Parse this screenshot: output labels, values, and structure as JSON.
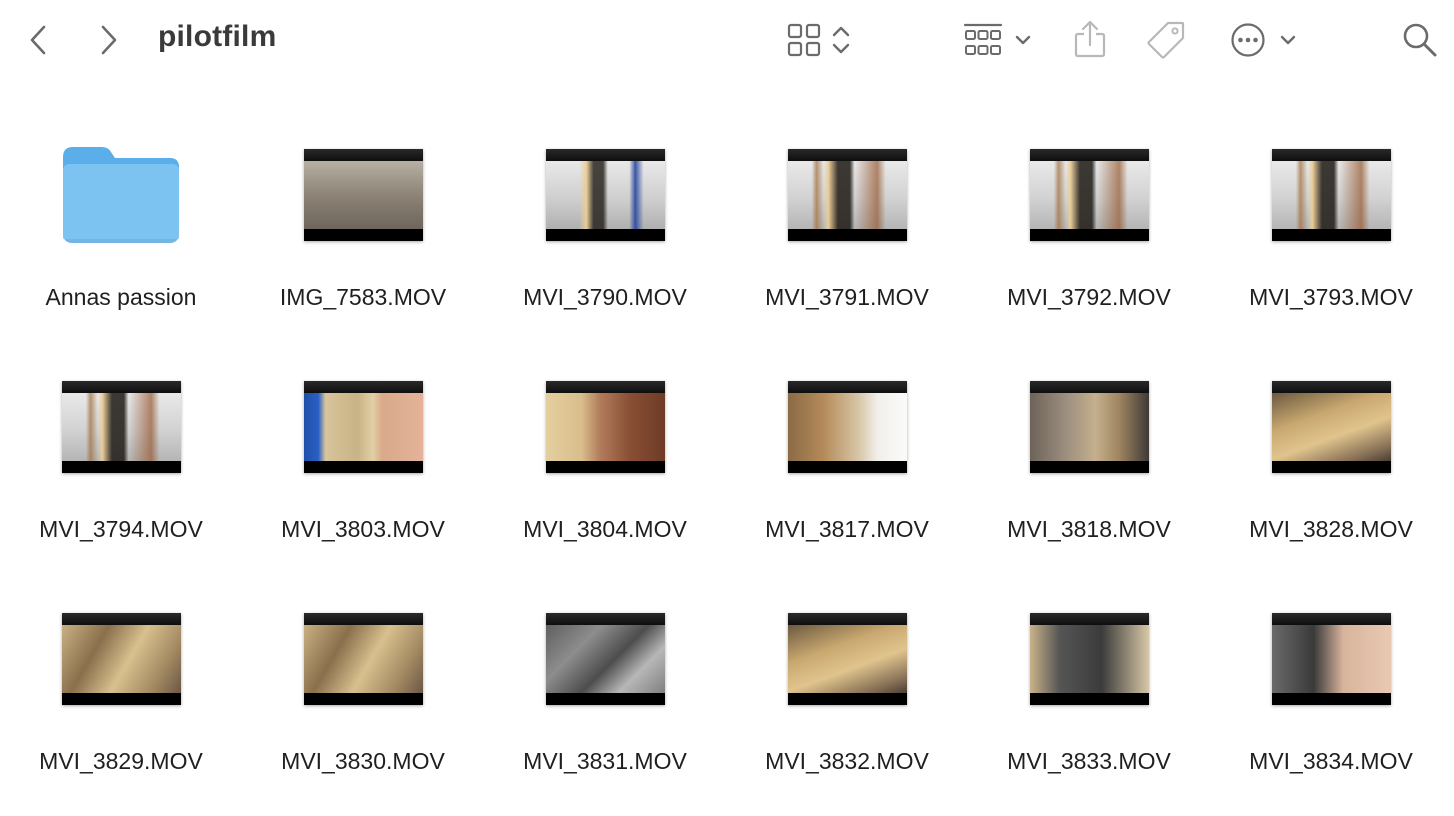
{
  "window": {
    "title": "pilotfilm"
  },
  "toolbar": {
    "back_icon": "chevron-left-icon",
    "forward_icon": "chevron-right-icon",
    "view_icon": "icon-grid-view-icon",
    "group_icon": "group-by-icon",
    "share_icon": "share-icon",
    "tag_icon": "tag-icon",
    "more_icon": "ellipsis-circle-icon",
    "search_icon": "search-icon"
  },
  "items": [
    {
      "name": "Annas passion",
      "kind": "folder"
    },
    {
      "name": "IMG_7583.MOV",
      "kind": "video",
      "look": "f-grey"
    },
    {
      "name": "MVI_3790.MOV",
      "kind": "video",
      "look": "f-lab2"
    },
    {
      "name": "MVI_3791.MOV",
      "kind": "video",
      "look": "f-lab3"
    },
    {
      "name": "MVI_3792.MOV",
      "kind": "video",
      "look": "f-lab3"
    },
    {
      "name": "MVI_3793.MOV",
      "kind": "video",
      "look": "f-lab3"
    },
    {
      "name": "MVI_3794.MOV",
      "kind": "video",
      "look": "f-lab3"
    },
    {
      "name": "MVI_3803.MOV",
      "kind": "video",
      "look": "f-hair"
    },
    {
      "name": "MVI_3804.MOV",
      "kind": "video",
      "look": "f-ear"
    },
    {
      "name": "MVI_3817.MOV",
      "kind": "video",
      "look": "f-bench"
    },
    {
      "name": "MVI_3818.MOV",
      "kind": "video",
      "look": "f-work"
    },
    {
      "name": "MVI_3828.MOV",
      "kind": "video",
      "look": "f-desk"
    },
    {
      "name": "MVI_3829.MOV",
      "kind": "video",
      "look": "f-desk2"
    },
    {
      "name": "MVI_3830.MOV",
      "kind": "video",
      "look": "f-desk2"
    },
    {
      "name": "MVI_3831.MOV",
      "kind": "video",
      "look": "f-steel"
    },
    {
      "name": "MVI_3832.MOV",
      "kind": "video",
      "look": "f-desk"
    },
    {
      "name": "MVI_3833.MOV",
      "kind": "video",
      "look": "f-anvil"
    },
    {
      "name": "MVI_3834.MOV",
      "kind": "video",
      "look": "f-anvil2"
    }
  ],
  "colors": {
    "folder": "#7cc3f2",
    "folder_tab": "#5aaeea",
    "icon": "#6b6b6b",
    "icon_disabled": "#b8b8b8"
  }
}
